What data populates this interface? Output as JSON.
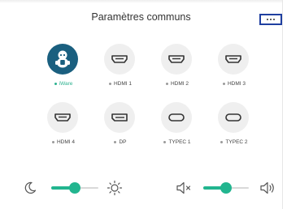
{
  "header": {
    "title": "Paramètres communs"
  },
  "sources": [
    {
      "label": "iWare",
      "icon": "robot-icon",
      "active": true
    },
    {
      "label": "HDMI 1",
      "icon": "hdmi-icon",
      "active": false
    },
    {
      "label": "HDMI 2",
      "icon": "hdmi-icon",
      "active": false
    },
    {
      "label": "HDMI 3",
      "icon": "hdmi-icon",
      "active": false
    },
    {
      "label": "HDMI 4",
      "icon": "hdmi-icon",
      "active": false
    },
    {
      "label": "DP",
      "icon": "displayport-icon",
      "active": false
    },
    {
      "label": "TYPEC 1",
      "icon": "usb-c-icon",
      "active": false
    },
    {
      "label": "TYPEC 2",
      "icon": "usb-c-icon",
      "active": false
    }
  ],
  "controls": {
    "brightness": {
      "level": 0.5,
      "low_icon": "moon-icon",
      "high_icon": "sun-icon"
    },
    "volume": {
      "level": 0.5,
      "low_icon": "mute-speaker-icon",
      "high_icon": "speaker-icon"
    }
  },
  "colors": {
    "accent": "#22b58f",
    "active_label": "#2bb18e",
    "active_circle": "#1a5f7f",
    "focus_border": "#1f3fa0"
  }
}
